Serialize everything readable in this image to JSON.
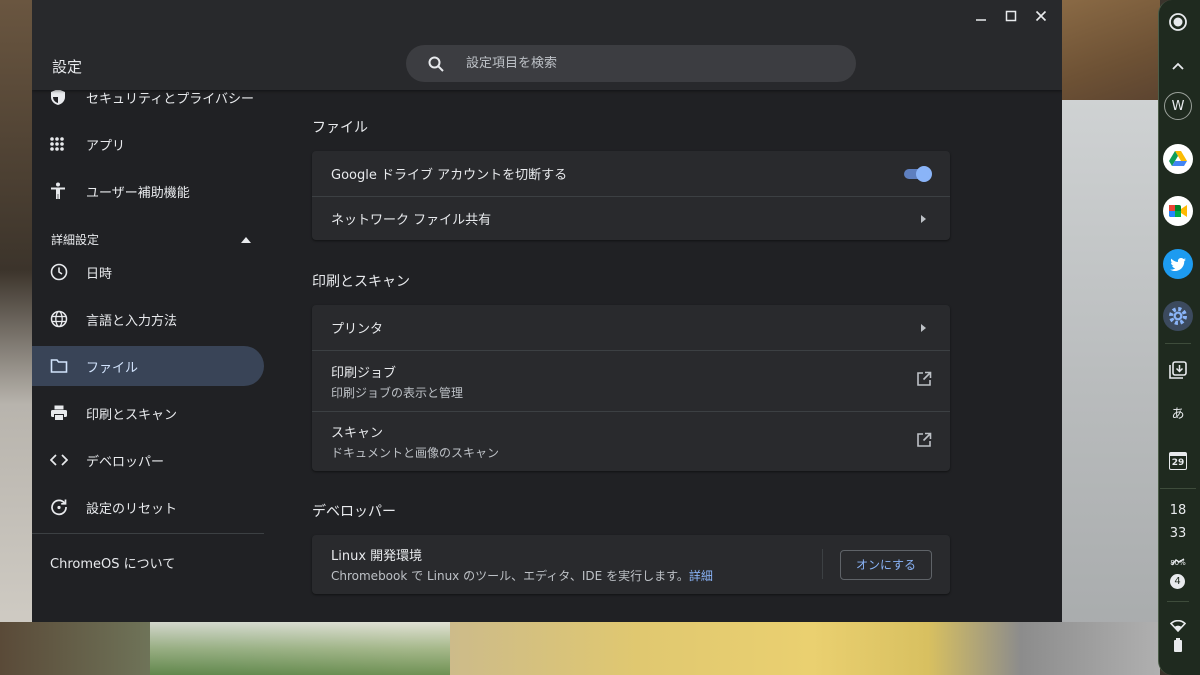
{
  "window": {
    "title": "設定",
    "controls": [
      "minimize",
      "maximize",
      "close"
    ]
  },
  "search": {
    "placeholder": "設定項目を検索"
  },
  "sidebar": {
    "items": [
      {
        "label": "セキュリティとプライバシー",
        "icon": "shield-icon"
      },
      {
        "label": "アプリ",
        "icon": "apps-grid-icon"
      },
      {
        "label": "ユーザー補助機能",
        "icon": "accessibility-icon"
      }
    ],
    "advanced": {
      "label": "詳細設定",
      "expanded": true
    },
    "advanced_items": [
      {
        "label": "日時",
        "icon": "clock-icon"
      },
      {
        "label": "言語と入力方法",
        "icon": "globe-icon"
      },
      {
        "label": "ファイル",
        "icon": "folder-icon",
        "active": true
      },
      {
        "label": "印刷とスキャン",
        "icon": "printer-icon"
      },
      {
        "label": "デベロッパー",
        "icon": "code-icon"
      },
      {
        "label": "設定のリセット",
        "icon": "reset-icon"
      }
    ],
    "about": "ChromeOS について"
  },
  "main": {
    "files": {
      "title": "ファイル",
      "rows": {
        "drive_disconnect": {
          "label": "Google ドライブ アカウントを切断する",
          "toggle_on": true
        },
        "network_share": {
          "label": "ネットワーク ファイル共有"
        }
      }
    },
    "printing": {
      "title": "印刷とスキャン",
      "rows": {
        "printers": {
          "label": "プリンタ"
        },
        "print_jobs": {
          "label": "印刷ジョブ",
          "sub": "印刷ジョブの表示と管理"
        },
        "scan": {
          "label": "スキャン",
          "sub": "ドキュメントと画像のスキャン"
        }
      }
    },
    "developer": {
      "title": "デベロッパー",
      "linux": {
        "label": "Linux 開発環境",
        "sub": "Chromebook で Linux のツール、エディタ、IDE を実行します。",
        "link": "詳細",
        "button": "オンにする"
      }
    }
  },
  "shelf": {
    "avatar_letter": "W",
    "ime_label": "あ",
    "calendar_day": "29",
    "clock_hour": "18",
    "clock_minute": "33",
    "battery_percent": "80%",
    "notification_count": "4",
    "apps": [
      "google-drive-icon",
      "google-meet-icon",
      "twitter-icon",
      "settings-gear-icon"
    ]
  },
  "colors": {
    "window_bg": "#202124",
    "card_bg": "#292a2d",
    "accent": "#8ab4f8",
    "active_nav": "#394457"
  }
}
